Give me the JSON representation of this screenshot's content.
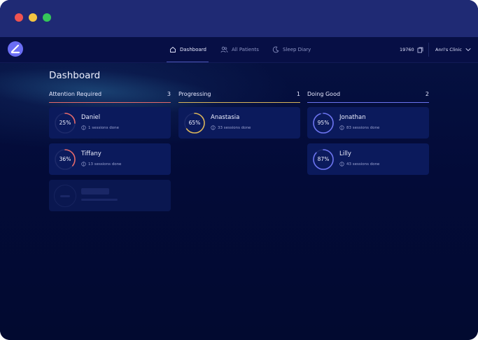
{
  "nav": {
    "tabs": [
      {
        "label": "Dashboard",
        "icon": "home-icon",
        "active": true
      },
      {
        "label": "All Patients",
        "icon": "users-icon",
        "active": false
      },
      {
        "label": "Sleep Diary",
        "icon": "moon-icon",
        "active": false
      }
    ],
    "credits": "19760",
    "clinic": "Anri's Clinic"
  },
  "page": {
    "title": "Dashboard"
  },
  "columns": [
    {
      "title": "Attention Required",
      "count": "3",
      "color": "#e56a6a",
      "patients": [
        {
          "name": "Daniel",
          "percent": "25%",
          "value": 0.25,
          "sessions": "1 sessions done"
        },
        {
          "name": "Tiffany",
          "percent": "36%",
          "value": 0.36,
          "sessions": "13 sessions done"
        }
      ]
    },
    {
      "title": "Progressing",
      "count": "1",
      "color": "#d9b45a",
      "patients": [
        {
          "name": "Anastasia",
          "percent": "65%",
          "value": 0.65,
          "sessions": "33 sessions done"
        }
      ]
    },
    {
      "title": "Doing Good",
      "count": "2",
      "color": "#6c74f0",
      "patients": [
        {
          "name": "Jonathan",
          "percent": "95%",
          "value": 0.95,
          "sessions": "83 sessions done"
        },
        {
          "name": "Lilly",
          "percent": "87%",
          "value": 0.87,
          "sessions": "43 sessions done"
        }
      ]
    }
  ]
}
